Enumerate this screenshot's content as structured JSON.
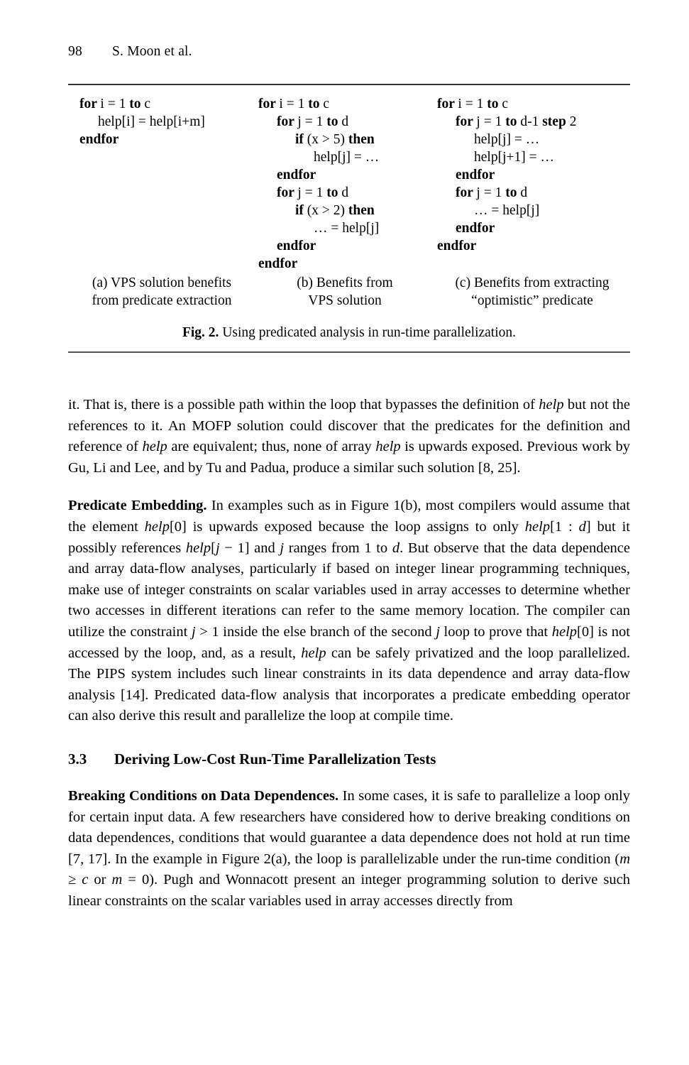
{
  "page": {
    "folio": "98",
    "running_head": "S. Moon et al."
  },
  "figure": {
    "columns": [
      {
        "id": "a",
        "lines": [
          {
            "indent": 0,
            "parts": [
              {
                "t": "for ",
                "b": true
              },
              {
                "t": "i = 1 ",
                "b": false
              },
              {
                "t": "to ",
                "b": true
              },
              {
                "t": "c",
                "b": false
              }
            ]
          },
          {
            "indent": 1,
            "parts": [
              {
                "t": "help[i] = help[i+m]",
                "b": false
              }
            ]
          },
          {
            "indent": 0,
            "parts": [
              {
                "t": "endfor",
                "b": true
              }
            ]
          }
        ],
        "caption_line1": "(a) VPS solution benefits",
        "caption_line2": "from predicate extraction"
      },
      {
        "id": "b",
        "lines": [
          {
            "indent": 0,
            "parts": [
              {
                "t": "for ",
                "b": true
              },
              {
                "t": "i = 1 ",
                "b": false
              },
              {
                "t": "to ",
                "b": true
              },
              {
                "t": "c",
                "b": false
              }
            ]
          },
          {
            "indent": 1,
            "parts": [
              {
                "t": "for ",
                "b": true
              },
              {
                "t": "j = 1 ",
                "b": false
              },
              {
                "t": "to ",
                "b": true
              },
              {
                "t": "d",
                "b": false
              }
            ]
          },
          {
            "indent": 2,
            "parts": [
              {
                "t": "if ",
                "b": true
              },
              {
                "t": "(x > 5) ",
                "b": false
              },
              {
                "t": "then",
                "b": true
              }
            ]
          },
          {
            "indent": 3,
            "parts": [
              {
                "t": "help[j] = …",
                "b": false
              }
            ]
          },
          {
            "indent": 1,
            "parts": [
              {
                "t": "endfor",
                "b": true
              }
            ]
          },
          {
            "indent": 1,
            "parts": [
              {
                "t": "for ",
                "b": true
              },
              {
                "t": "j = 1 ",
                "b": false
              },
              {
                "t": "to ",
                "b": true
              },
              {
                "t": "d",
                "b": false
              }
            ]
          },
          {
            "indent": 2,
            "parts": [
              {
                "t": "if ",
                "b": true
              },
              {
                "t": "(x > 2) ",
                "b": false
              },
              {
                "t": "then",
                "b": true
              }
            ]
          },
          {
            "indent": 3,
            "parts": [
              {
                "t": "… = help[j]",
                "b": false
              }
            ]
          },
          {
            "indent": 1,
            "parts": [
              {
                "t": "endfor",
                "b": true
              }
            ]
          },
          {
            "indent": 0,
            "parts": [
              {
                "t": "endfor",
                "b": true
              }
            ]
          }
        ],
        "caption_line1": "(b) Benefits from",
        "caption_line2": "VPS solution"
      },
      {
        "id": "c",
        "lines": [
          {
            "indent": 0,
            "parts": [
              {
                "t": "for ",
                "b": true
              },
              {
                "t": "i = 1 ",
                "b": false
              },
              {
                "t": "to ",
                "b": true
              },
              {
                "t": "c",
                "b": false
              }
            ]
          },
          {
            "indent": 1,
            "parts": [
              {
                "t": "for ",
                "b": true
              },
              {
                "t": "j = 1 ",
                "b": false
              },
              {
                "t": "to ",
                "b": true
              },
              {
                "t": "d-1 ",
                "b": false
              },
              {
                "t": "step ",
                "b": true
              },
              {
                "t": "2",
                "b": false
              }
            ]
          },
          {
            "indent": 2,
            "parts": [
              {
                "t": "help[j] = …",
                "b": false
              }
            ]
          },
          {
            "indent": 2,
            "parts": [
              {
                "t": "help[j+1] = …",
                "b": false
              }
            ]
          },
          {
            "indent": 1,
            "parts": [
              {
                "t": "endfor",
                "b": true
              }
            ]
          },
          {
            "indent": 1,
            "parts": [
              {
                "t": "for ",
                "b": true
              },
              {
                "t": "j = 1 ",
                "b": false
              },
              {
                "t": "to ",
                "b": true
              },
              {
                "t": "d",
                "b": false
              }
            ]
          },
          {
            "indent": 2,
            "parts": [
              {
                "t": "… = help[j]",
                "b": false
              }
            ]
          },
          {
            "indent": 1,
            "parts": [
              {
                "t": "endfor",
                "b": true
              }
            ]
          },
          {
            "indent": 0,
            "parts": [
              {
                "t": "endfor",
                "b": true
              }
            ]
          }
        ],
        "caption_line1": "(c) Benefits from extracting",
        "caption_line2": "“optimistic” predicate"
      }
    ],
    "caption_label": "Fig. 2.",
    "caption_text": " Using predicated analysis in run-time parallelization."
  },
  "body": {
    "para1": [
      {
        "t": "it. That is, there is a possible path within the loop that bypasses the definition of ",
        "i": false
      },
      {
        "t": "help",
        "i": true
      },
      {
        "t": " but not the references to it. An MOFP solution could discover that the predicates for the definition and reference of ",
        "i": false
      },
      {
        "t": "help",
        "i": true
      },
      {
        "t": " are equivalent; thus, none of array ",
        "i": false
      },
      {
        "t": "help",
        "i": true
      },
      {
        "t": " is upwards exposed. Previous work by Gu, Li and Lee, and by Tu and Padua, produce a similar such solution [8, 25].",
        "i": false
      }
    ],
    "para2_runin": "Predicate Embedding.",
    "para2": [
      {
        "t": " In examples such as in Figure 1(b), most compilers would assume that the element ",
        "i": false
      },
      {
        "t": "help",
        "i": true
      },
      {
        "t": "[0] is upwards exposed because the loop assigns to only ",
        "i": false
      },
      {
        "t": "help",
        "i": true
      },
      {
        "t": "[1 : ",
        "i": false
      },
      {
        "t": "d",
        "i": true
      },
      {
        "t": "] but it possibly references ",
        "i": false
      },
      {
        "t": "help",
        "i": true
      },
      {
        "t": "[",
        "i": false
      },
      {
        "t": "j",
        "i": true
      },
      {
        "t": " − 1] and ",
        "i": false
      },
      {
        "t": "j",
        "i": true
      },
      {
        "t": " ranges from 1 to ",
        "i": false
      },
      {
        "t": "d",
        "i": true
      },
      {
        "t": ". But observe that the data dependence and array data-flow analyses, particularly if based on integer linear programming techniques, make use of integer constraints on scalar variables used in array accesses to determine whether two accesses in different iterations can refer to the same memory location. The compiler can utilize the constraint ",
        "i": false
      },
      {
        "t": "j",
        "i": true
      },
      {
        "t": " > 1 inside the else branch of the second ",
        "i": false
      },
      {
        "t": "j",
        "i": true
      },
      {
        "t": " loop to prove that ",
        "i": false
      },
      {
        "t": "help",
        "i": true
      },
      {
        "t": "[0] is not accessed by the loop, and, as a result, ",
        "i": false
      },
      {
        "t": "help",
        "i": true
      },
      {
        "t": " can be safely privatized and the loop parallelized. The PIPS system includes such linear constraints in its data dependence and array data-flow analysis [14]. Predicated data-flow analysis that incorporates a predicate embedding operator can also derive this result and parallelize the loop at compile time.",
        "i": false
      }
    ],
    "section_number": "3.3",
    "section_title": "Deriving Low-Cost Run-Time Parallelization Tests",
    "para3_runin": "Breaking Conditions on Data Dependences.",
    "para3": [
      {
        "t": " In some cases, it is safe to parallelize a loop only for certain input data. A few researchers have considered how to derive breaking conditions on data dependences, conditions that would guarantee a data dependence does not hold at run time [7, 17]. In the example in Figure 2(a), the loop is parallelizable under the run-time condition (",
        "i": false
      },
      {
        "t": "m",
        "i": true
      },
      {
        "t": " ≥ ",
        "i": false
      },
      {
        "t": "c",
        "i": true
      },
      {
        "t": " or ",
        "i": false
      },
      {
        "t": "m",
        "i": true
      },
      {
        "t": " = 0). Pugh and Wonnacott present an integer programming solution to derive such linear constraints on the scalar variables used in array accesses directly from",
        "i": false
      }
    ]
  }
}
